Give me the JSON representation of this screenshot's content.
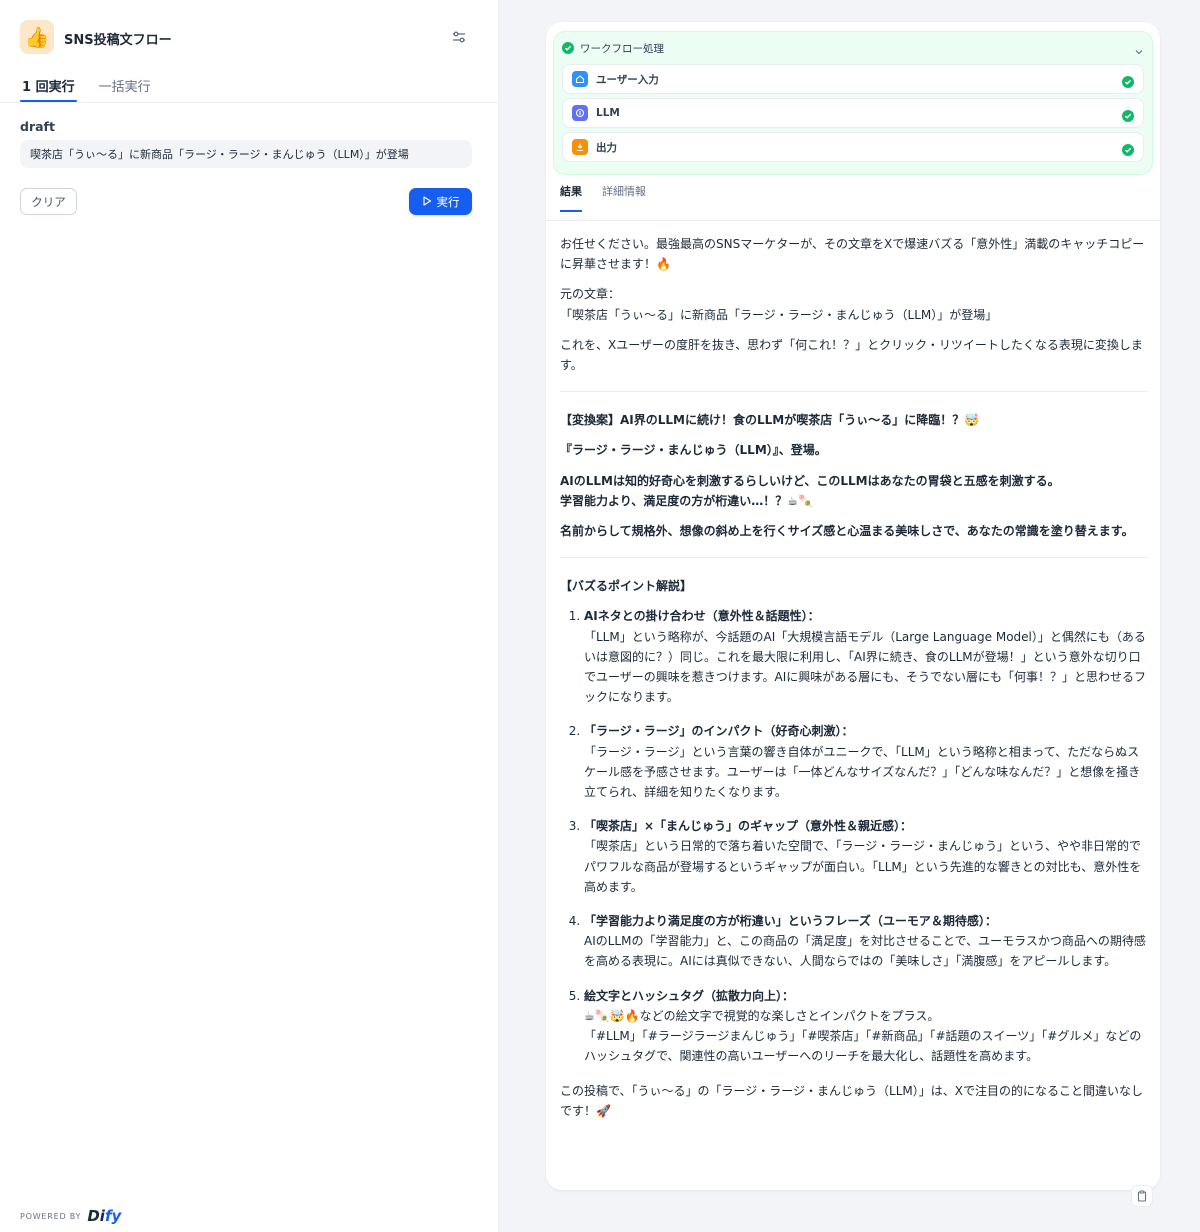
{
  "app": {
    "icon": "👍",
    "title": "SNS投稿文フロー",
    "settings_icon": "sliders-icon"
  },
  "left_tabs": [
    {
      "label": "1 回実行",
      "active": true
    },
    {
      "label": "一括実行",
      "active": false
    }
  ],
  "form": {
    "field_label": "draft",
    "field_value": "喫茶店「うぃ〜る」に新商品「ラージ・ラージ・まんじゅう（LLM）」が登場",
    "clear_label": "クリア",
    "run_label": "実行"
  },
  "footer": {
    "powered_by": "POWERED BY",
    "brand_prefix": "Di",
    "brand_accent": "fy"
  },
  "workflow": {
    "title": "ワークフロー処理",
    "nodes": [
      {
        "label": "ユーザー入力",
        "icon": "home-icon",
        "color": "#2e90fa"
      },
      {
        "label": "LLM",
        "icon": "llm-icon",
        "color": "#6172f3"
      },
      {
        "label": "出力",
        "icon": "flag-icon",
        "color": "#f79009"
      }
    ],
    "accent_color": "#12b76a"
  },
  "right_tabs": [
    {
      "label": "結果",
      "active": true
    },
    {
      "label": "詳細情報",
      "active": false
    }
  ],
  "result": {
    "intro": "お任せください。最強最高のSNSマーケターが、その文章をXで爆速バズる「意外性」満載のキャッチコピーに昇華させます！🔥",
    "orig_label": "元の文章：",
    "orig_text": "「喫茶店「うぃ〜る」に新商品「ラージ・ラージ・まんじゅう（LLM）」が登場」",
    "convert_desc": "これを、Xユーザーの度肝を抜き、思わず「何これ！？」とクリック・リツイートしたくなる表現に変換します。",
    "proposal_title": "【変換案】AI界のLLMに続け！食のLLMが喫茶店「うぃ〜る」に降臨！？🤯",
    "proposal_line2": "『ラージ・ラージ・まんじゅう（LLM）』、登場。",
    "proposal_line3": "AIのLLMは知的好奇心を刺激するらしいけど、このLLMはあなたの胃袋と五感を刺激する。",
    "proposal_line4": "学習能力より、満足度の方が桁違い…！？☕🍡",
    "proposal_line5": "名前からして規格外、想像の斜め上を行くサイズ感と心温まる美味しさで、あなたの常識を塗り替えます。",
    "points_title": "【バズるポイント解説】",
    "points": [
      {
        "title": "AIネタとの掛け合わせ（意外性＆話題性）：",
        "body": "「LLM」という略称が、今話題のAI「大規模言語モデル（Large Language Model）」と偶然にも（あるいは意図的に？）同じ。これを最大限に利用し、「AI界に続き、食のLLMが登場！」という意外な切り口でユーザーの興味を惹きつけます。AIに興味がある層にも、そうでない層にも「何事！？」と思わせるフックになります。"
      },
      {
        "title": "「ラージ・ラージ」のインパクト（好奇心刺激）：",
        "body": "「ラージ・ラージ」という言葉の響き自体がユニークで、「LLM」という略称と相まって、ただならぬスケール感を予感させます。ユーザーは「一体どんなサイズなんだ？」「どんな味なんだ？」と想像を掻き立てられ、詳細を知りたくなります。"
      },
      {
        "title": "「喫茶店」×「まんじゅう」のギャップ（意外性＆親近感）：",
        "body": "「喫茶店」という日常的で落ち着いた空間で、「ラージ・ラージ・まんじゅう」という、やや非日常的でパワフルな商品が登場するというギャップが面白い。「LLM」という先進的な響きとの対比も、意外性を高めます。"
      },
      {
        "title": "「学習能力より満足度の方が桁違い」というフレーズ（ユーモア＆期待感）：",
        "body": "AIのLLMの「学習能力」と、この商品の「満足度」を対比させることで、ユーモラスかつ商品への期待感を高める表現に。AIには真似できない、人間ならではの「美味しさ」「満腹感」をアピールします。"
      },
      {
        "title": "絵文字とハッシュタグ（拡散力向上）：",
        "body": "☕🍡🤯🔥などの絵文字で視覚的な楽しさとインパクトをプラス。",
        "body2": "「#LLM」「#ラージラージまんじゅう」「#喫茶店」「#新商品」「#話題のスイーツ」「#グルメ」などのハッシュタグで、関連性の高いユーザーへのリーチを最大化し、話題性を高めます。"
      }
    ],
    "closing": "この投稿で、「うぃ〜る」の「ラージ・ラージ・まんじゅう（LLM）」は、Xで注目の的になること間違いなしです！🚀"
  },
  "copy_icon": "clipboard-icon"
}
